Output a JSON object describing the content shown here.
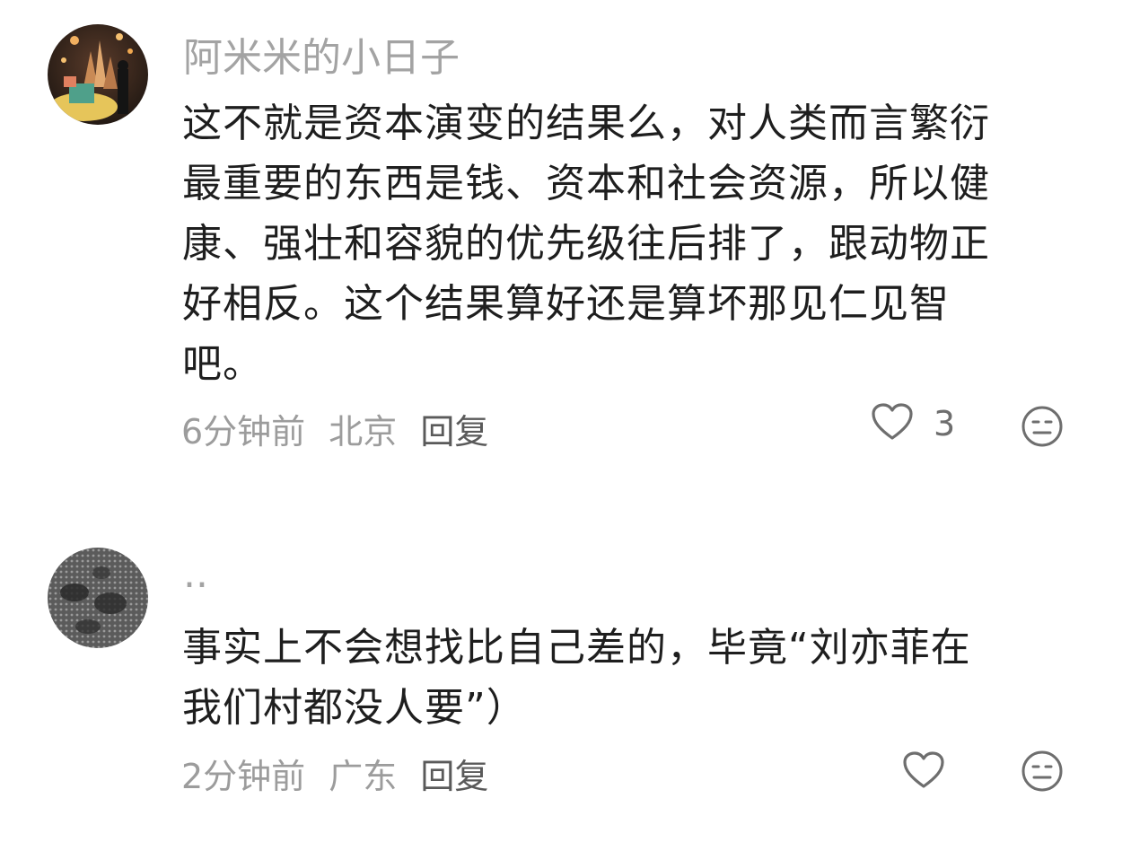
{
  "comments": [
    {
      "username": "阿米米的小日子",
      "lines": [
        "这不就是资本演变的结果么，对人类而言繁衍",
        "最重要的东西是钱、资本和社会资源，所以健",
        "康、强壮和容貌的优先级往后排了，跟动物正",
        "好相反。这个结果算好还是算坏那见仁见智",
        "吧。"
      ],
      "time": "6分钟前",
      "location": "北京",
      "reply_label": "回复",
      "like_count": "3",
      "avatar_icon": "avatar-castle-night",
      "like_icon": "heart-outline-icon",
      "emoji_icon": "neutral-face-icon"
    },
    {
      "username": "..",
      "lines": [
        "事实上不会想找比自己差的，毕竟“刘亦菲在",
        "我们村都没人要”）"
      ],
      "time": "2分钟前",
      "location": "广东",
      "reply_label": "回复",
      "avatar_icon": "avatar-pattern-mesh",
      "like_icon": "heart-outline-icon",
      "emoji_icon": "neutral-face-icon"
    }
  ]
}
